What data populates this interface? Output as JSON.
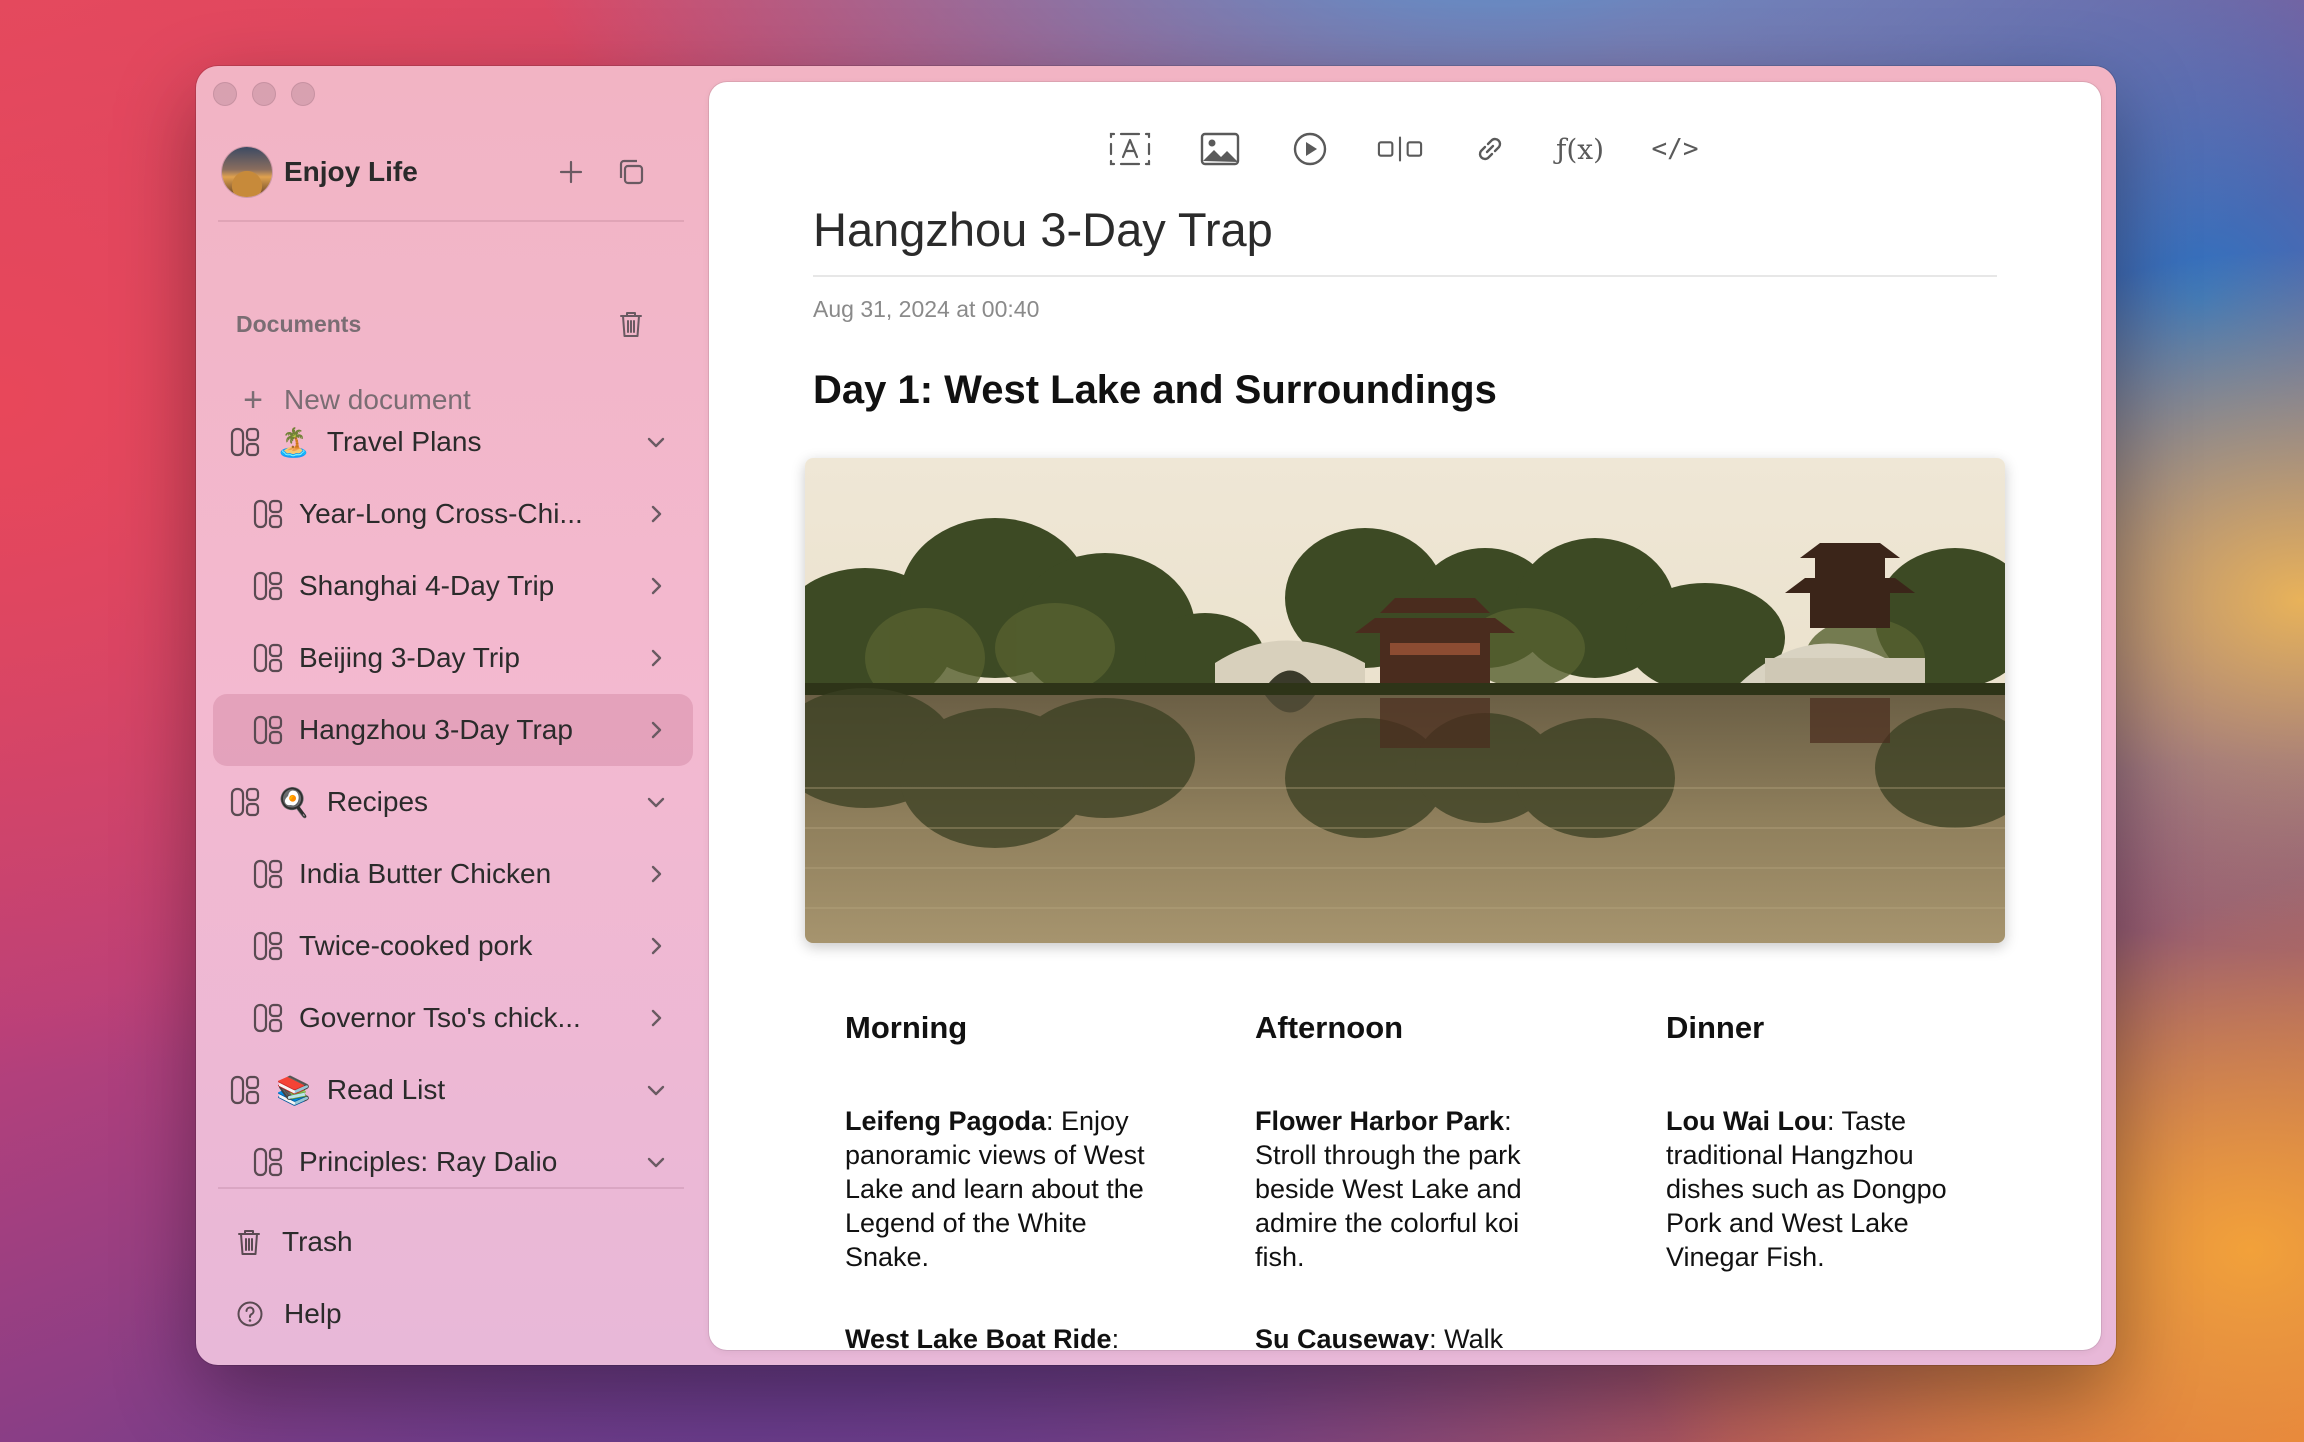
{
  "window": {
    "profile_name": "Enjoy Life"
  },
  "sidebar": {
    "section_title": "Documents",
    "new_document": "New document",
    "items": [
      {
        "label": "Travel Plans",
        "emoji": "🏝️",
        "level": 0,
        "chevron": "down"
      },
      {
        "label": "Year-Long Cross-Chi...",
        "level": 1,
        "chevron": "right"
      },
      {
        "label": "Shanghai 4-Day Trip",
        "level": 1,
        "chevron": "right"
      },
      {
        "label": "Beijing 3-Day Trip",
        "level": 1,
        "chevron": "right"
      },
      {
        "label": "Hangzhou 3-Day Trap",
        "level": 1,
        "chevron": "right",
        "selected": true
      },
      {
        "label": "Recipes",
        "emoji": "🍳",
        "level": 0,
        "chevron": "down"
      },
      {
        "label": "India Butter Chicken",
        "level": 1,
        "chevron": "right"
      },
      {
        "label": "Twice-cooked pork",
        "level": 1,
        "chevron": "right"
      },
      {
        "label": "Governor Tso's chick...",
        "level": 1,
        "chevron": "right"
      },
      {
        "label": "Read List",
        "emoji": "📚",
        "level": 0,
        "chevron": "down"
      },
      {
        "label": "Principles: Ray Dalio",
        "level": 1,
        "chevron": "down"
      }
    ],
    "trash": "Trash",
    "help": "Help"
  },
  "toolbar": {
    "tools": [
      "text-box-icon",
      "image-icon",
      "play-icon",
      "columns-icon",
      "link-icon",
      "function-icon",
      "code-icon"
    ],
    "function_label": "ƒ(x)",
    "code_label": "</>"
  },
  "document": {
    "title": "Hangzhou 3-Day Trap",
    "date": "Aug 31, 2024 at 00:40",
    "heading": "Day 1: West Lake and Surroundings",
    "columns": [
      {
        "title": "Morning",
        "entries": [
          {
            "bold": "Leifeng Pagoda",
            "text": ": Enjoy panoramic views of West Lake and learn about the Legend of the White Snake."
          },
          {
            "bold": "West Lake Boat Ride",
            "text": ":"
          }
        ]
      },
      {
        "title": "Afternoon",
        "entries": [
          {
            "bold": "Flower Harbor Park",
            "text": ": Stroll through the park beside West Lake and admire the colorful koi fish."
          },
          {
            "bold": "Su Causeway",
            "text": ": Walk"
          }
        ]
      },
      {
        "title": "Dinner",
        "entries": [
          {
            "bold": "Lou Wai Lou",
            "text": ": Taste traditional Hangzhou dishes such as Dongpo Pork and West Lake Vinegar Fish."
          }
        ]
      }
    ]
  }
}
